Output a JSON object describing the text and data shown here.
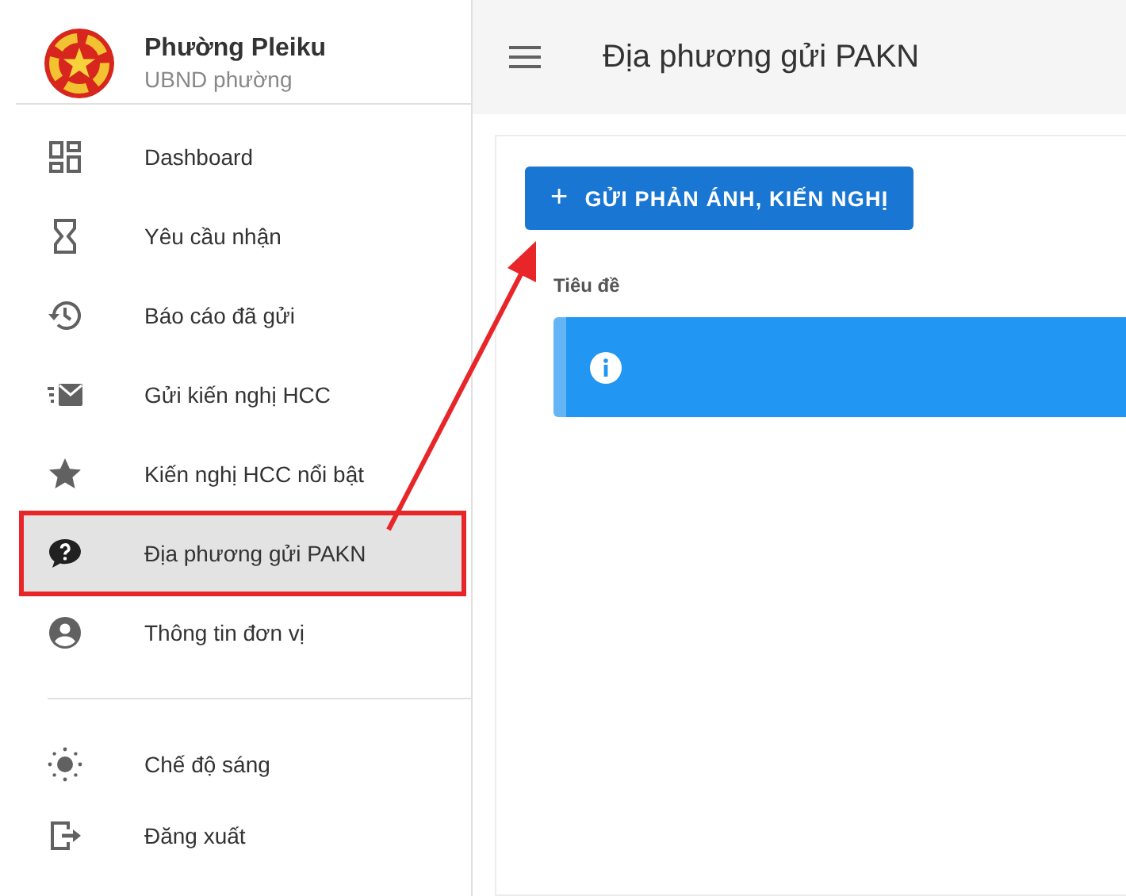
{
  "sidebar": {
    "org_name": "Phường Pleiku",
    "org_type": "UBND phường",
    "items": [
      {
        "kind": "dashboard",
        "label": "Dashboard",
        "selected": false,
        "highlighted": false
      },
      {
        "kind": "hourglass",
        "label": "Yêu cầu nhận",
        "selected": false,
        "highlighted": false
      },
      {
        "kind": "history",
        "label": "Báo cáo đã gửi",
        "selected": false,
        "highlighted": false
      },
      {
        "kind": "mail",
        "label": "Gửi kiến nghị HCC",
        "selected": false,
        "highlighted": false
      },
      {
        "kind": "star",
        "label": "Kiến nghị HCC nổi bật",
        "selected": false,
        "highlighted": false
      },
      {
        "kind": "question",
        "label": "Địa phương gửi PAKN",
        "selected": true,
        "highlighted": true
      },
      {
        "kind": "account",
        "label": "Thông tin đơn vị",
        "selected": false,
        "highlighted": false
      }
    ],
    "footer_items": [
      {
        "kind": "sun",
        "label": "Chế độ sáng"
      },
      {
        "kind": "logout",
        "label": "Đăng xuất"
      }
    ]
  },
  "header": {
    "title": "Địa phương gửi PAKN"
  },
  "content": {
    "add_button": {
      "icon": "+",
      "label": "GỬI PHẢN ÁNH, KIẾN NGHỊ"
    },
    "column_header": "Tiêu đề",
    "alert": {
      "kind": "info"
    }
  }
}
